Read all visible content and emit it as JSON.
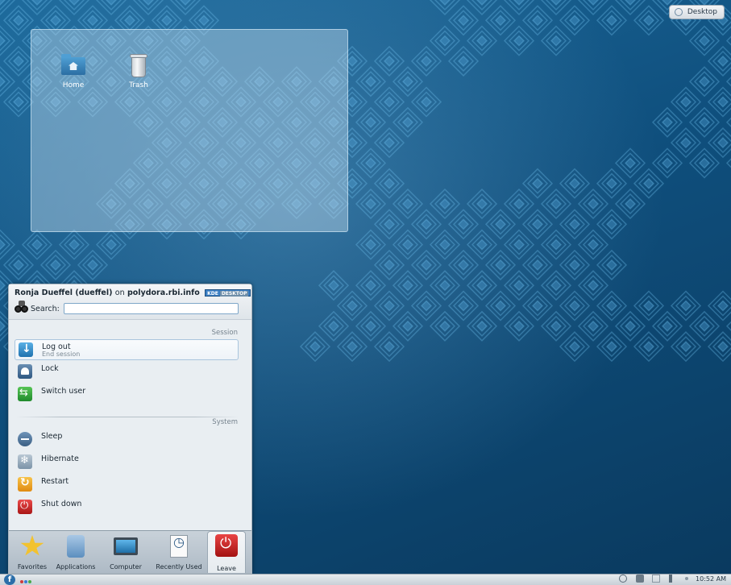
{
  "desktop": {
    "toolbox_label": "Desktop",
    "icons": [
      {
        "label": "Home",
        "icon": "home-folder-icon"
      },
      {
        "label": "Trash",
        "icon": "trash-icon"
      }
    ]
  },
  "launcher": {
    "user_name": "Ronja Dueffel (dueffel)",
    "on_text": "on",
    "host": "polydora.rbi.info",
    "badge_a": "KDE",
    "badge_b": "DESKTOP",
    "search_label": "Search:",
    "search_value": "",
    "session_header": "Session",
    "system_header": "System",
    "session_items": [
      {
        "title": "Log out",
        "subtitle": "End session",
        "icon": "log-out-icon"
      },
      {
        "title": "Lock",
        "subtitle": "",
        "icon": "lock-icon"
      },
      {
        "title": "Switch user",
        "subtitle": "",
        "icon": "switch-user-icon"
      }
    ],
    "system_items": [
      {
        "title": "Sleep",
        "icon": "sleep-icon"
      },
      {
        "title": "Hibernate",
        "icon": "hibernate-icon"
      },
      {
        "title": "Restart",
        "icon": "restart-icon"
      },
      {
        "title": "Shut down",
        "icon": "shutdown-icon"
      }
    ],
    "tabs": [
      {
        "label": "Favorites",
        "icon": "star-icon"
      },
      {
        "label": "Applications",
        "icon": "applications-icon"
      },
      {
        "label": "Computer",
        "icon": "computer-icon"
      },
      {
        "label": "Recently Used",
        "icon": "recently-used-icon"
      },
      {
        "label": "Leave",
        "icon": "leave-icon",
        "active": true
      }
    ]
  },
  "panel": {
    "kicker_glyph": "f",
    "clock": "10:52 AM",
    "colors": {
      "accent": "#2b6ea9"
    }
  }
}
